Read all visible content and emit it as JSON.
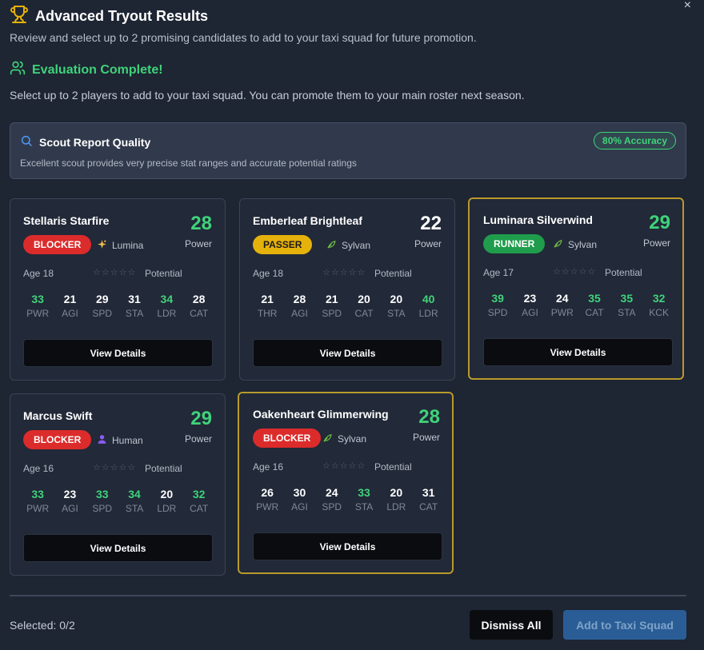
{
  "header": {
    "title": "Advanced Tryout Results",
    "subtitle": "Review and select up to 2 promising candidates to add to your taxi squad for future promotion.",
    "close_label": "×"
  },
  "evaluation": {
    "title": "Evaluation Complete!",
    "instruction": "Select up to 2 players to add to your taxi squad. You can promote them to your main roster next season."
  },
  "scout": {
    "title": "Scout Report Quality",
    "description": "Excellent scout provides very precise stat ranges and accurate potential ratings",
    "badge": "80% Accuracy"
  },
  "labels": {
    "power": "Power",
    "potential": "Potential",
    "view_details": "View Details",
    "stars": "☆☆☆☆☆"
  },
  "colors": {
    "green": "#3fd37a",
    "blocker": "#dc2b2b",
    "passer": "#e5b10b",
    "runner": "#1f9d4c",
    "selected_border": "#b8992b"
  },
  "players": [
    {
      "name": "Stellaris Starfire",
      "power": "28",
      "power_highlight": true,
      "position": "BLOCKER",
      "position_color": "#dc2b2b",
      "position_text_color": "#ffffff",
      "race": "Lumina",
      "race_icon": "sparkle-icon",
      "age": "Age 18",
      "selected": false,
      "stats": [
        {
          "v": "33",
          "l": "PWR",
          "g": true
        },
        {
          "v": "21",
          "l": "AGI",
          "g": false
        },
        {
          "v": "29",
          "l": "SPD",
          "g": false
        },
        {
          "v": "31",
          "l": "STA",
          "g": false
        },
        {
          "v": "34",
          "l": "LDR",
          "g": true
        },
        {
          "v": "28",
          "l": "CAT",
          "g": false
        }
      ]
    },
    {
      "name": "Emberleaf Brightleaf",
      "power": "22",
      "power_highlight": false,
      "position": "PASSER",
      "position_color": "#e5b10b",
      "position_text_color": "#1a1a1a",
      "race": "Sylvan",
      "race_icon": "leaf-icon",
      "age": "Age 18",
      "selected": false,
      "stats": [
        {
          "v": "21",
          "l": "THR",
          "g": false
        },
        {
          "v": "28",
          "l": "AGI",
          "g": false
        },
        {
          "v": "21",
          "l": "SPD",
          "g": false
        },
        {
          "v": "20",
          "l": "CAT",
          "g": false
        },
        {
          "v": "20",
          "l": "STA",
          "g": false
        },
        {
          "v": "40",
          "l": "LDR",
          "g": true
        }
      ]
    },
    {
      "name": "Luminara Silverwind",
      "power": "29",
      "power_highlight": true,
      "position": "RUNNER",
      "position_color": "#1f9d4c",
      "position_text_color": "#ffffff",
      "race": "Sylvan",
      "race_icon": "leaf-icon",
      "age": "Age 17",
      "selected": true,
      "stats": [
        {
          "v": "39",
          "l": "SPD",
          "g": true
        },
        {
          "v": "23",
          "l": "AGI",
          "g": false
        },
        {
          "v": "24",
          "l": "PWR",
          "g": false
        },
        {
          "v": "35",
          "l": "CAT",
          "g": true
        },
        {
          "v": "35",
          "l": "STA",
          "g": true
        },
        {
          "v": "32",
          "l": "KCK",
          "g": true
        }
      ]
    },
    {
      "name": "Marcus Swift",
      "power": "29",
      "power_highlight": true,
      "position": "BLOCKER",
      "position_color": "#dc2b2b",
      "position_text_color": "#ffffff",
      "race": "Human",
      "race_icon": "person-icon",
      "age": "Age 16",
      "selected": false,
      "stats": [
        {
          "v": "33",
          "l": "PWR",
          "g": true
        },
        {
          "v": "23",
          "l": "AGI",
          "g": false
        },
        {
          "v": "33",
          "l": "SPD",
          "g": true
        },
        {
          "v": "34",
          "l": "STA",
          "g": true
        },
        {
          "v": "20",
          "l": "LDR",
          "g": false
        },
        {
          "v": "32",
          "l": "CAT",
          "g": true
        }
      ]
    },
    {
      "name": "Oakenheart Glimmerwing",
      "power": "28",
      "power_highlight": true,
      "position": "BLOCKER",
      "position_color": "#dc2b2b",
      "position_text_color": "#ffffff",
      "race": "Sylvan",
      "race_icon": "leaf-icon",
      "age": "Age 16",
      "selected": true,
      "stats": [
        {
          "v": "26",
          "l": "PWR",
          "g": false
        },
        {
          "v": "30",
          "l": "AGI",
          "g": false
        },
        {
          "v": "24",
          "l": "SPD",
          "g": false
        },
        {
          "v": "33",
          "l": "STA",
          "g": true
        },
        {
          "v": "20",
          "l": "LDR",
          "g": false
        },
        {
          "v": "31",
          "l": "CAT",
          "g": false
        }
      ]
    }
  ],
  "footer": {
    "selected_text": "Selected: 0/2",
    "dismiss_label": "Dismiss All",
    "add_label": "Add to Taxi Squad"
  }
}
